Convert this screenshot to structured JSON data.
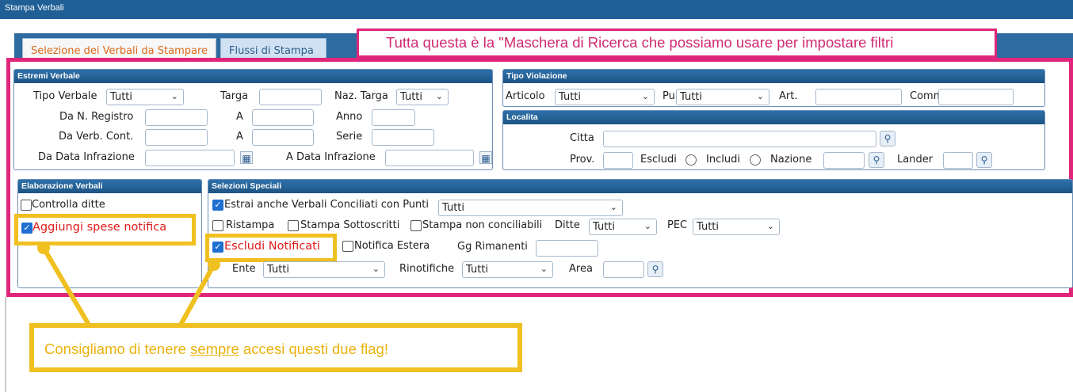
{
  "window": {
    "title": "Stampa Verbali"
  },
  "tabs": [
    {
      "label": "Selezione dei Verbali da Stampare",
      "active": true
    },
    {
      "label": "Flussi di Stampa",
      "active": false
    }
  ],
  "annotation_top": "Tutta questa è la \"Maschera di Ricerca che possiamo usare per impostare filtri",
  "estremi": {
    "header": "Estremi Verbale",
    "tipo_verbale_label": "Tipo Verbale",
    "tipo_verbale_value": "Tutti",
    "targa_label": "Targa",
    "naz_targa_label": "Naz. Targa",
    "naz_targa_value": "Tutti",
    "da_n_registro_label": "Da N. Registro",
    "a_label_1": "A",
    "anno_label": "Anno",
    "da_verb_cont_label": "Da Verb. Cont.",
    "a_label_2": "A",
    "serie_label": "Serie",
    "da_data_label": "Da Data Infrazione",
    "a_data_label": "A Data Infrazione"
  },
  "violazione": {
    "header": "Tipo Violazione",
    "articolo_label": "Articolo",
    "articolo_value": "Tutti",
    "punti_label": "Punti",
    "punti_value": "Tutti",
    "art_label": "Art.",
    "comma_label": "Comma"
  },
  "localita": {
    "header": "Localita",
    "citta_label": "Citta",
    "prov_label": "Prov.",
    "escludi_label": "Escludi",
    "includi_label": "Includi",
    "nazione_label": "Nazione",
    "lander_label": "Lander"
  },
  "elaborazione": {
    "header": "Elaborazione Verbali",
    "controlla_ditte_label": "Controlla ditte",
    "controlla_ditte_checked": false,
    "aggiungi_spese_label": "Aggiungi spese notifica",
    "aggiungi_spese_checked": true
  },
  "speciali": {
    "header": "Selezioni Speciali",
    "estrai_label": "Estrai anche Verbali Conciliati con Punti",
    "estrai_checked": true,
    "estrai_value": "Tutti",
    "ristampa_label": "Ristampa",
    "stampa_sottoscritti_label": "Stampa Sottoscritti",
    "stampa_non_conciliabili_label": "Stampa non conciliabili",
    "ditte_label": "Ditte",
    "ditte_value": "Tutti",
    "pec_label": "PEC",
    "pec_value": "Tutti",
    "escludi_notificati_label": "Escludi Notificati",
    "escludi_notificati_checked": true,
    "notifica_estera_label": "Notifica Estera",
    "gg_rimanenti_label": "Gg Rimanenti",
    "ente_label": "Ente",
    "ente_value": "Tutti",
    "rinotifiche_label": "Rinotifiche",
    "rinotifiche_value": "Tutti",
    "area_label": "Area"
  },
  "annotation_bottom": {
    "before": "Consigliamo di tenere ",
    "underlined": "sempre",
    "after": " accesi questi due flag!"
  },
  "colors": {
    "titlebar": "#1f5f95",
    "highlight_pink": "#e0267a",
    "highlight_yellow": "#f0c020",
    "red_text": "#e01a1a"
  }
}
